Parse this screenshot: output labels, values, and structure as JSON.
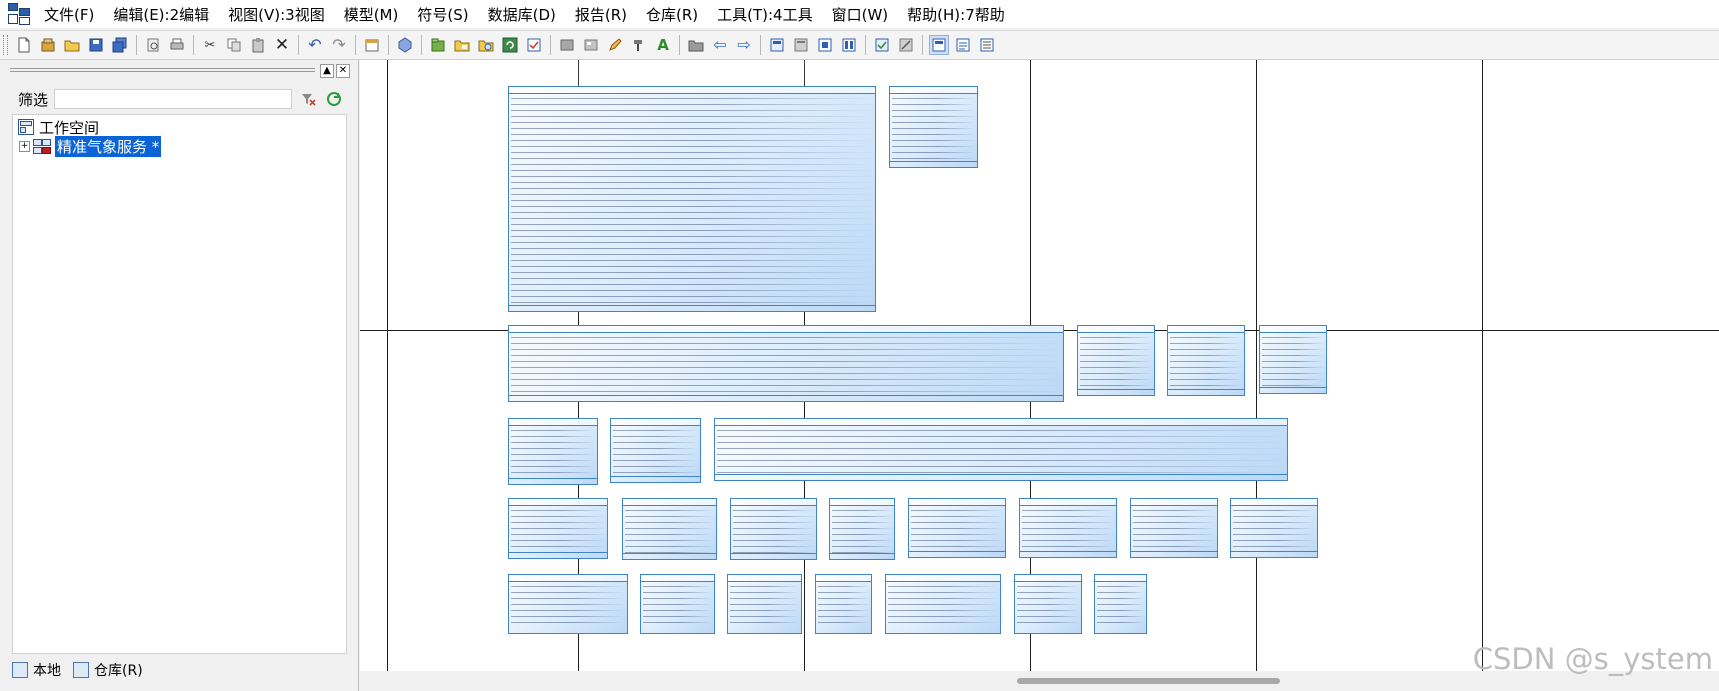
{
  "menubar": {
    "items": [
      {
        "label": "文件(F)"
      },
      {
        "label": "编辑(E):2编辑"
      },
      {
        "label": "视图(V):3视图"
      },
      {
        "label": "模型(M)"
      },
      {
        "label": "符号(S)"
      },
      {
        "label": "数据库(D)"
      },
      {
        "label": "报告(R)"
      },
      {
        "label": "仓库(R)"
      },
      {
        "label": "工具(T):4工具"
      },
      {
        "label": "窗口(W)"
      },
      {
        "label": "帮助(H):7帮助"
      }
    ]
  },
  "panel": {
    "controls": {
      "restore": "▲",
      "close": "✕"
    },
    "filter": {
      "label": "筛选",
      "value": "",
      "placeholder": ""
    },
    "tree": {
      "root": {
        "label": "工作空间"
      },
      "model": {
        "label": "精准气象服务 *",
        "expander": "+"
      }
    },
    "tabs": [
      {
        "label": "本地"
      },
      {
        "label": "仓库(R)"
      }
    ]
  },
  "watermark": "CSDN @s_ystem"
}
